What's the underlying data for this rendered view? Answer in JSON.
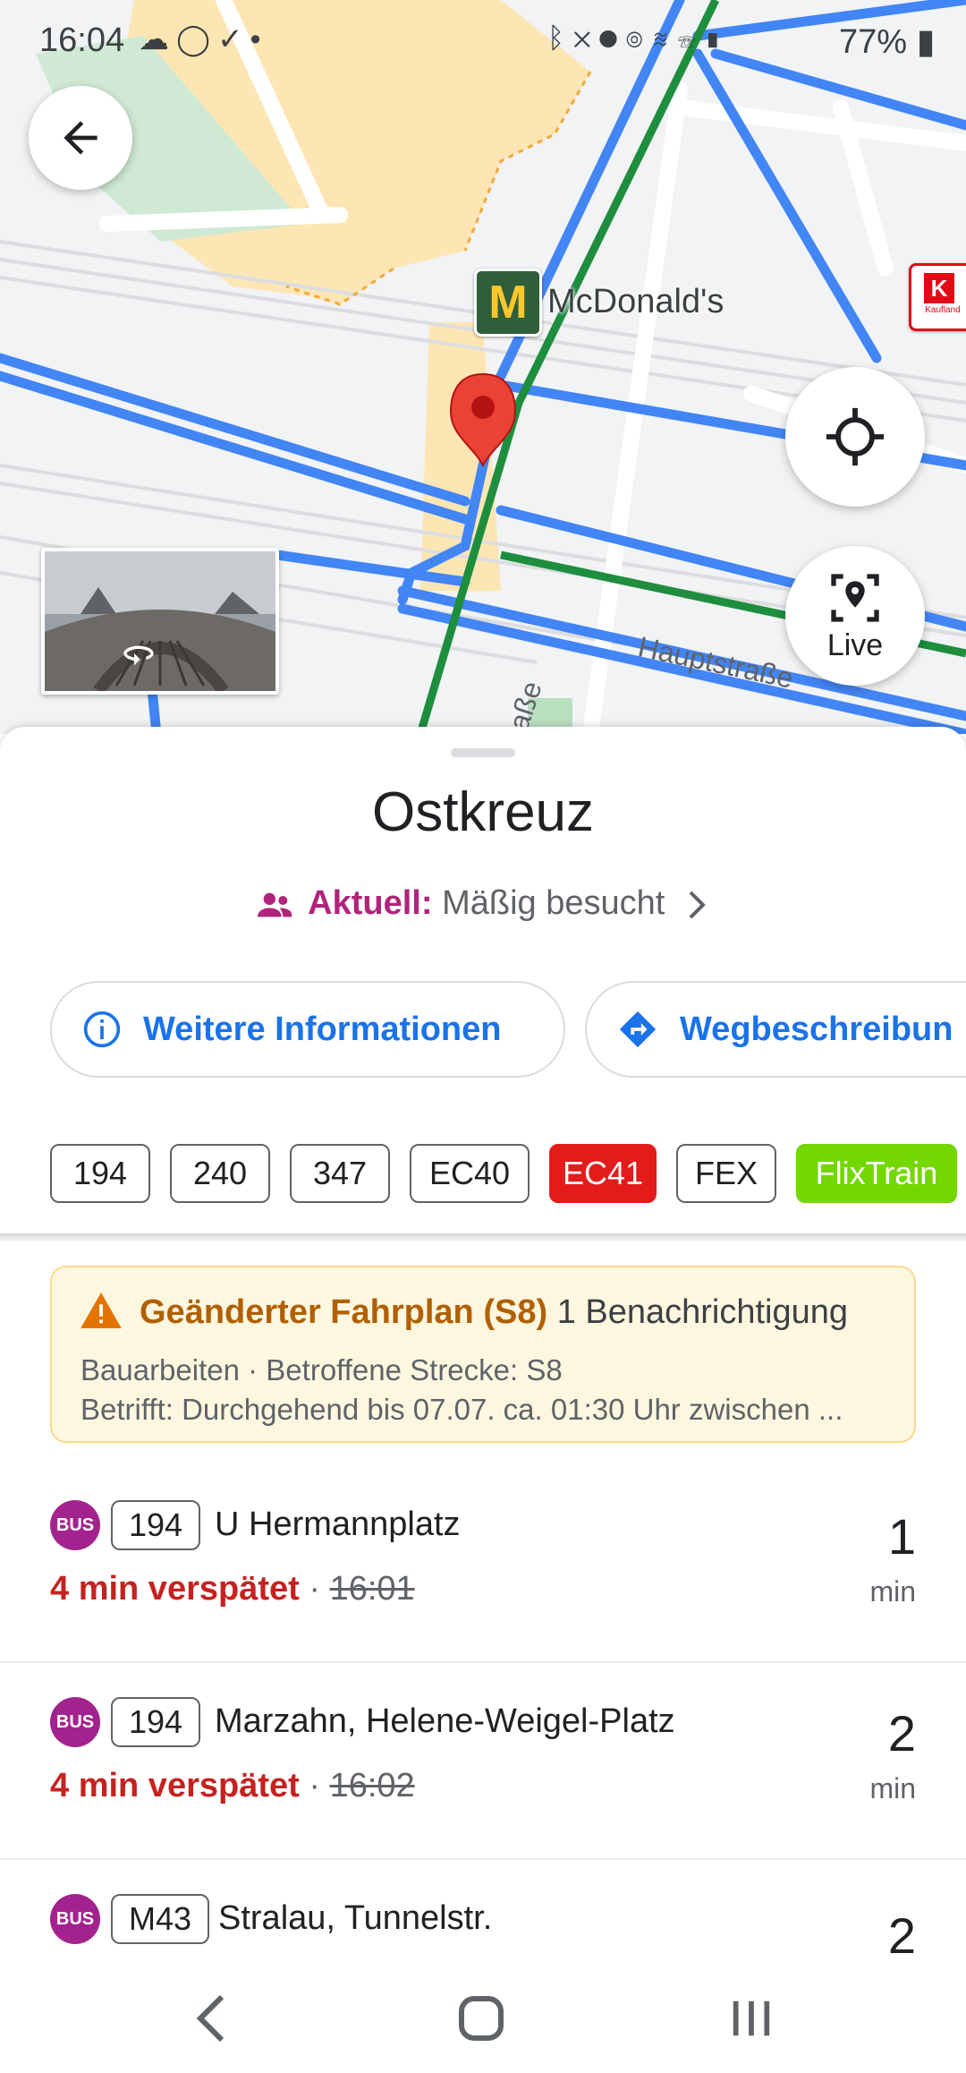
{
  "status_bar": {
    "time": "16:04",
    "battery": "77%",
    "left_icons": [
      "cloud-icon",
      "whatsapp-icon",
      "check-circle-icon",
      "dot-icon"
    ],
    "right_icons": [
      "bluetooth-icon",
      "mute-icon",
      "location-icon",
      "hotspot-icon",
      "wifi-icon",
      "wifi-calling-icon",
      "signal-icon",
      "battery-icon"
    ]
  },
  "map": {
    "poi_mcdonalds": "McDonald's",
    "street_hauptstrasse": "Hauptstraße",
    "street_partial": "aße",
    "live_label": "Live",
    "kaufland_text": "Kaufland"
  },
  "place": {
    "title": "Ostkreuz",
    "popularity_label": "Aktuell:",
    "popularity_status": "Mäßig besucht"
  },
  "actions": {
    "info": "Weitere Informationen",
    "directions": "Wegbeschreibun"
  },
  "lines": [
    "194",
    "240",
    "347",
    "EC40",
    "EC41",
    "FEX",
    "FlixTrain"
  ],
  "alert": {
    "title": "Geänderter Fahrplan (S8)",
    "count": "1 Benachrichtigung",
    "line1": "Bauarbeiten · Betroffene Strecke: S8",
    "line2": "Betrifft: Durchgehend bis 07.07. ca. 01:30 Uhr zwischen ..."
  },
  "departures": [
    {
      "mode": "BUS",
      "route": "194",
      "destination": "U Hermannplatz",
      "delay": "4 min verspätet",
      "sep": "·",
      "scheduled": "16:01",
      "minutes": "1",
      "unit": "min"
    },
    {
      "mode": "BUS",
      "route": "194",
      "destination": "Marzahn, Helene-Weigel-Platz",
      "delay": "4 min verspätet",
      "sep": "·",
      "scheduled": "16:02",
      "minutes": "2",
      "unit": "min"
    },
    {
      "mode": "BUS",
      "route": "M43",
      "destination": "Stralau, Tunnelstr.",
      "minutes": "2"
    }
  ],
  "colors": {
    "accent_blue": "#1a73e8",
    "transit_blue": "#4285f4",
    "late_red": "#c5221f",
    "bus_purple": "#a3238e",
    "ec41_red": "#e31b1b",
    "flixtrain_green": "#73d700",
    "alert_bg": "#fef7e0"
  }
}
